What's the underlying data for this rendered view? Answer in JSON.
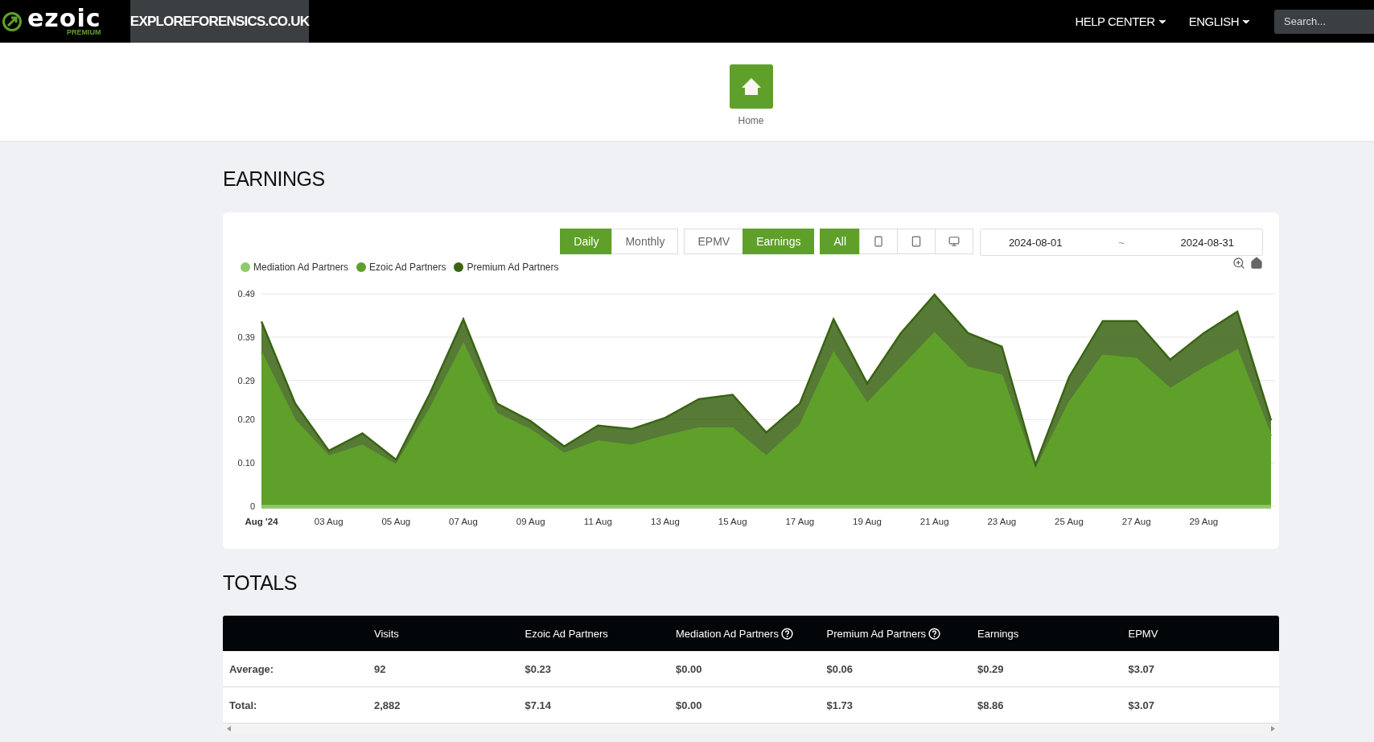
{
  "header": {
    "brand": {
      "name": "ezoic",
      "tier": "PREMIUM"
    },
    "site": "EXPLOREFORENSICS.CO.UK",
    "menus": [
      {
        "label": "HELP CENTER"
      },
      {
        "label": "ENGLISH"
      }
    ],
    "search": {
      "placeholder": "Search..."
    }
  },
  "nav": {
    "home": {
      "label": "Home"
    }
  },
  "earnings": {
    "title": "EARNINGS",
    "period_toggle": [
      {
        "label": "Daily",
        "selected": true
      },
      {
        "label": "Monthly",
        "selected": false
      }
    ],
    "metric_toggle": [
      {
        "label": "EPMV",
        "selected": false
      },
      {
        "label": "Earnings",
        "selected": true
      }
    ],
    "device_filter": [
      {
        "kind": "all",
        "label": "All",
        "selected": true
      },
      {
        "kind": "phone",
        "selected": false
      },
      {
        "kind": "tablet",
        "selected": false
      },
      {
        "kind": "desktop",
        "selected": false
      }
    ],
    "date_range": {
      "start": "2024-08-01",
      "separator": "~",
      "end": "2024-08-31"
    },
    "chart_data": {
      "type": "area",
      "stacked": true,
      "grid": true,
      "ylim": [
        0,
        0.49
      ],
      "yticks": [
        0,
        {
          "value": 0.1,
          "label": "0.10"
        },
        {
          "value": 0.2,
          "label": "0.20"
        },
        {
          "value": 0.29,
          "label": "0.29"
        },
        {
          "value": 0.39,
          "label": "0.39"
        },
        {
          "value": 0.49,
          "label": "0.49"
        }
      ],
      "categories": [
        "Aug '24",
        null,
        "03 Aug",
        null,
        "05 Aug",
        null,
        "07 Aug",
        null,
        "09 Aug",
        null,
        "11 Aug",
        null,
        "13 Aug",
        null,
        "15 Aug",
        null,
        "17 Aug",
        null,
        "19 Aug",
        null,
        "21 Aug",
        null,
        "23 Aug",
        null,
        "25 Aug",
        null,
        "27 Aug",
        null,
        "29 Aug",
        null,
        null
      ],
      "series": [
        {
          "name": "Mediation Ad Partners",
          "color": "#8fc96b",
          "values": [
            0,
            0,
            0,
            0,
            0,
            0,
            0,
            0,
            0,
            0,
            0,
            0,
            0,
            0,
            0,
            0,
            0,
            0,
            0,
            0,
            0,
            0,
            0,
            0,
            0,
            0,
            0,
            0,
            0,
            0,
            0
          ]
        },
        {
          "name": "Ezoic Ad Partners",
          "color": "#5fa02a",
          "values": [
            0.354,
            0.198,
            0.115,
            0.14,
            0.095,
            0.223,
            0.374,
            0.213,
            0.176,
            0.121,
            0.15,
            0.14,
            0.162,
            0.18,
            0.18,
            0.115,
            0.186,
            0.354,
            0.237,
            0.318,
            0.399,
            0.32,
            0.302,
            0.083,
            0.239,
            0.348,
            0.34,
            0.271,
            0.318,
            0.36,
            0.162
          ]
        },
        {
          "name": "Premium Ad Partners",
          "color": "#3a6414",
          "values": [
            0.072,
            0.039,
            0.013,
            0.028,
            0.012,
            0.036,
            0.057,
            0.024,
            0.02,
            0.017,
            0.036,
            0.038,
            0.042,
            0.067,
            0.077,
            0.055,
            0.051,
            0.077,
            0.046,
            0.081,
            0.089,
            0.079,
            0.066,
            0.012,
            0.059,
            0.079,
            0.087,
            0.067,
            0.081,
            0.089,
            0.036
          ]
        }
      ]
    }
  },
  "totals": {
    "title": "TOTALS",
    "columns": [
      {
        "label": "Visits",
        "has_help": false
      },
      {
        "label": "Ezoic Ad Partners",
        "has_help": false
      },
      {
        "label": "Mediation Ad Partners",
        "has_help": true
      },
      {
        "label": "Premium Ad Partners",
        "has_help": true
      },
      {
        "label": "Earnings",
        "has_help": false
      },
      {
        "label": "EPMV",
        "has_help": false
      }
    ],
    "rows": [
      {
        "label": "Average:",
        "cells": [
          "92",
          "$0.23",
          "$0.00",
          "$0.06",
          "$0.29",
          "$3.07"
        ]
      },
      {
        "label": "Total:",
        "cells": [
          "2,882",
          "$7.14",
          "$0.00",
          "$1.73",
          "$8.86",
          "$3.07"
        ]
      }
    ]
  }
}
